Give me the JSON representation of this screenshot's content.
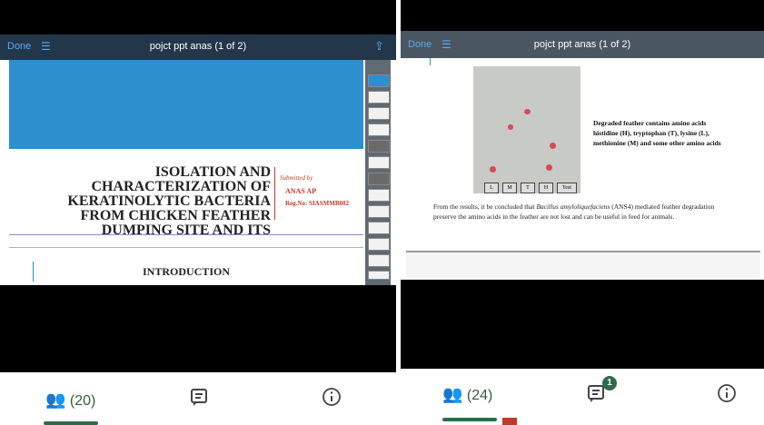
{
  "left": {
    "toolbar": {
      "done_label": "Done",
      "list_icon": "list-icon",
      "title": "pojct ppt anas (1 of 2)",
      "share_icon": "share-icon"
    },
    "slide": {
      "title_lines": [
        "ISOLATION AND",
        "CHARACTERIZATION OF",
        "KERATINOLYTIC BACTERIA",
        "FROM CHICKEN FEATHER",
        "DUMPING SITE AND ITS"
      ],
      "submitted_by": "Submitted by",
      "author": "ANAS AP",
      "reg_no": "Reg.No: SIASMMB002",
      "next_heading": "INTRODUCTION"
    },
    "nav": {
      "participants_label": "(20)"
    }
  },
  "right": {
    "toolbar": {
      "done_label": "Done",
      "title": "pojct ppt anas (1 of 2)"
    },
    "slide": {
      "caption_lines": [
        "Degraded feather contains amino acids",
        "histidine (H), tryptophan (T), lysine (L),",
        "methionine (M) and some other amino acids"
      ],
      "lanes": [
        "L",
        "M",
        "T",
        "H",
        "Test"
      ],
      "conclusion_before": "From the results, it be concluded that ",
      "conclusion_italic": "Bacillus amyloliquefaciens",
      "conclusion_after": " (ANS4) mediated feather degradation",
      "conclusion_line2": "preserve the amino acids in the feather are not lost and can be useful in feed for animals."
    },
    "nav": {
      "participants_label": "(24)",
      "chat_badge": "1"
    }
  },
  "colors": {
    "toolbar": "#24364a",
    "accent_blue": "#2e8fcf",
    "nav_green": "#2f5d3d",
    "submitted_red": "#c0392b"
  }
}
